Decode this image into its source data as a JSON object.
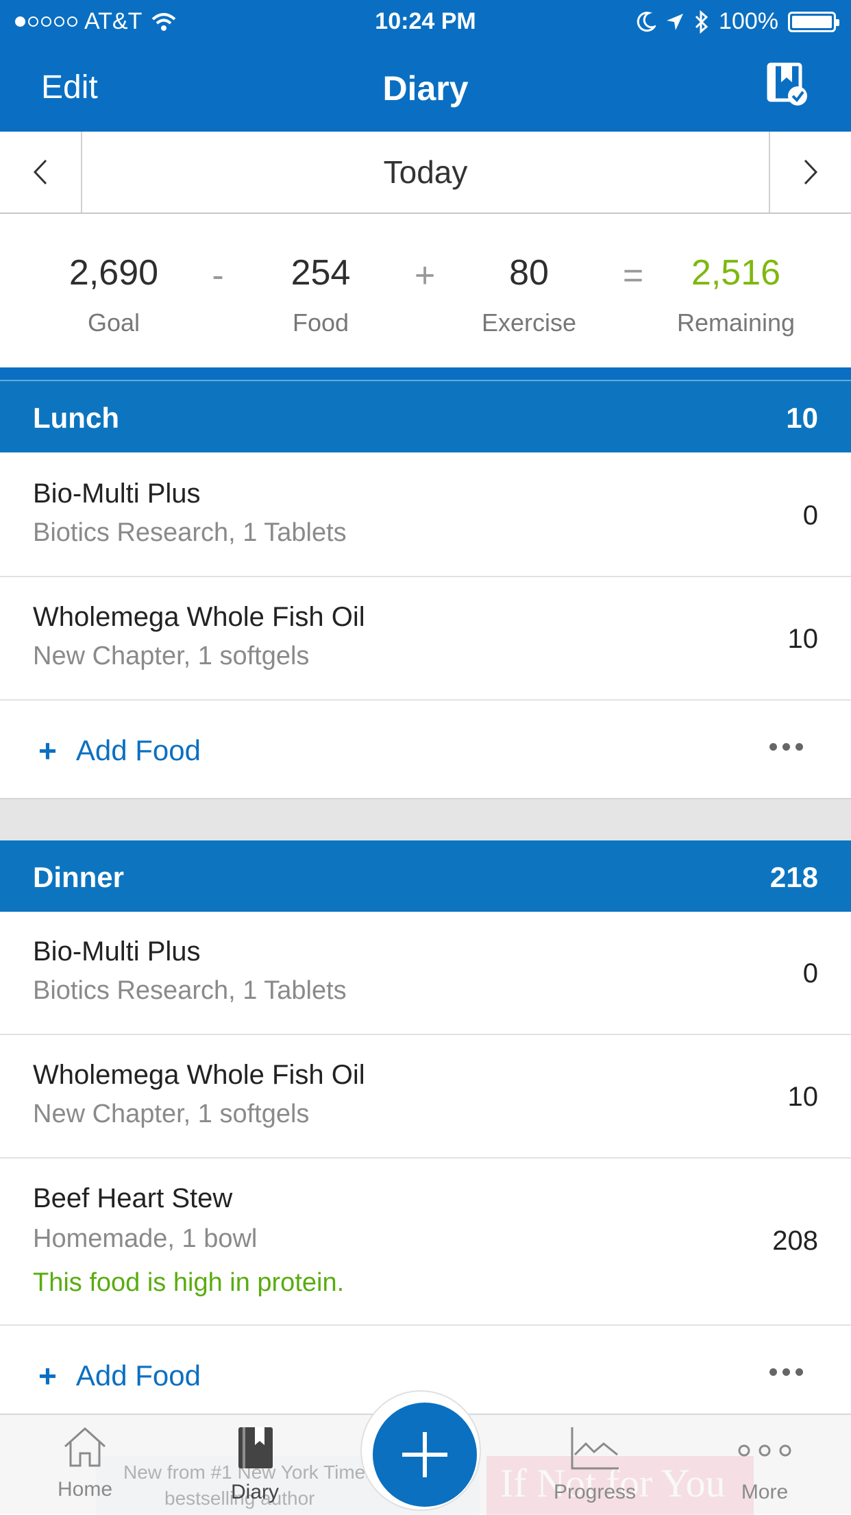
{
  "status_bar": {
    "carrier": "AT&T",
    "time": "10:24 PM",
    "battery": "100%"
  },
  "nav": {
    "edit": "Edit",
    "title": "Diary"
  },
  "date": {
    "label": "Today"
  },
  "summary": {
    "goal_value": "2,690",
    "goal_label": "Goal",
    "op1": "-",
    "food_value": "254",
    "food_label": "Food",
    "op2": "+",
    "exercise_value": "80",
    "exercise_label": "Exercise",
    "op3": "=",
    "remaining_value": "2,516",
    "remaining_label": "Remaining",
    "remaining_color": "#7eb80e"
  },
  "meals": [
    {
      "name": "Lunch",
      "calories": "10",
      "items": [
        {
          "name": "Bio-Multi Plus",
          "detail": "Biotics Research, 1 Tablets",
          "calories": "0"
        },
        {
          "name": "Wholemega Whole Fish Oil",
          "detail": "New Chapter, 1 softgels",
          "calories": "10"
        }
      ],
      "add_label": "Add Food"
    },
    {
      "name": "Dinner",
      "calories": "218",
      "items": [
        {
          "name": "Bio-Multi Plus",
          "detail": "Biotics Research, 1 Tablets",
          "calories": "0"
        },
        {
          "name": "Wholemega Whole Fish Oil",
          "detail": "New Chapter, 1 softgels",
          "calories": "10"
        },
        {
          "name": "Beef Heart Stew",
          "detail": "Homemade, 1 bowl",
          "note": "This food is high in protein.",
          "calories": "208"
        }
      ],
      "add_label": "Add Food"
    }
  ],
  "tabs": [
    {
      "label": "Home",
      "icon": "home-icon"
    },
    {
      "label": "Diary",
      "icon": "diary-icon"
    },
    {
      "label": "Progress",
      "icon": "progress-icon"
    },
    {
      "label": "More",
      "icon": "more-icon"
    }
  ],
  "ad": {
    "left_line1": "New from #1 New York Times",
    "left_line2": "bestselling author",
    "right_text": "If Not for You"
  },
  "colors": {
    "brand_blue": "#0a6fc2",
    "protein_note": "#59ac0f"
  }
}
